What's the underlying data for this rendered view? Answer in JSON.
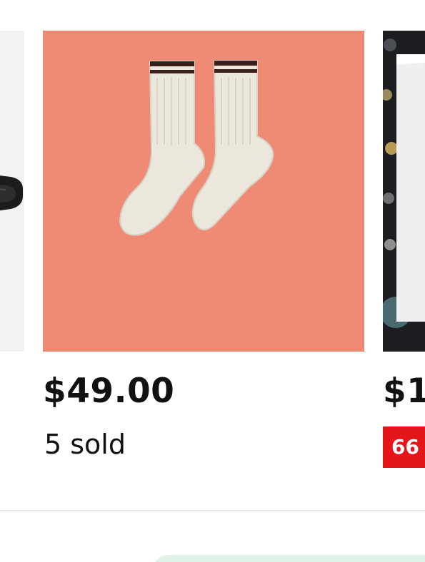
{
  "products": [
    {
      "id_label": "product-left",
      "image_desc_icon": "belt-image"
    },
    {
      "price": "$49.00",
      "sold": "5 sold",
      "image_bg": "#ef8a75"
    },
    {
      "price": "$1",
      "discount": "66",
      "discount_color": "#e4161b"
    }
  ],
  "colors": {
    "main_image_bg": "#ef8a75",
    "sock_color": "#ece7dc",
    "stripe_color": "#3a1f1c",
    "badge_red": "#e4161b"
  }
}
